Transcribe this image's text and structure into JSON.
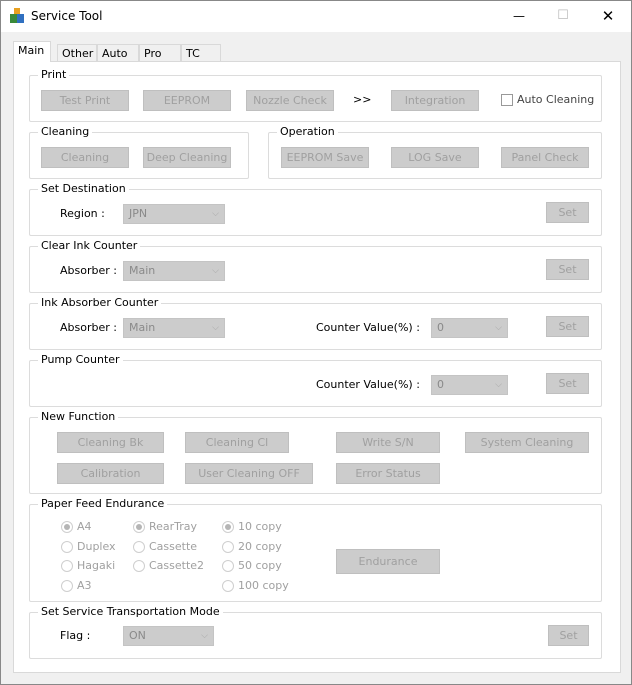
{
  "window": {
    "title": "Service Tool",
    "minimize": "—",
    "maximize": "☐",
    "close": "✕"
  },
  "tabs": [
    "Main",
    "Other",
    "Auto",
    "Pro",
    "TC"
  ],
  "print": {
    "label": "Print",
    "test_print": "Test Print",
    "eeprom": "EEPROM",
    "nozzle_check": "Nozzle Check",
    "arrow": ">>",
    "integration": "Integration",
    "auto_cleaning": "Auto Cleaning",
    "auto_cleaning_checked": false
  },
  "cleaning": {
    "label": "Cleaning",
    "cleaning": "Cleaning",
    "deep_cleaning": "Deep Cleaning"
  },
  "operation": {
    "label": "Operation",
    "eeprom_save": "EEPROM Save",
    "log_save": "LOG Save",
    "panel_check": "Panel Check"
  },
  "set_destination": {
    "label": "Set Destination",
    "region_label": "Region :",
    "region_value": "JPN",
    "set": "Set"
  },
  "clear_ink_counter": {
    "label": "Clear Ink Counter",
    "absorber_label": "Absorber :",
    "absorber_value": "Main",
    "set": "Set"
  },
  "ink_absorber_counter": {
    "label": "Ink Absorber Counter",
    "absorber_label": "Absorber :",
    "absorber_value": "Main",
    "counter_label": "Counter Value(%) :",
    "counter_value": "0",
    "set": "Set"
  },
  "pump_counter": {
    "label": "Pump Counter",
    "counter_label": "Counter Value(%) :",
    "counter_value": "0",
    "set": "Set"
  },
  "new_function": {
    "label": "New Function",
    "cleaning_bk": "Cleaning Bk",
    "cleaning_cl": "Cleaning Cl",
    "write_sn": "Write S/N",
    "system_cleaning": "System Cleaning",
    "calibration": "Calibration",
    "user_cleaning_off": "User Cleaning OFF",
    "error_status": "Error Status"
  },
  "paper_feed": {
    "label": "Paper Feed Endurance",
    "size": [
      "A4",
      "Duplex",
      "Hagaki",
      "A3"
    ],
    "tray": [
      "RearTray",
      "Cassette",
      "Cassette2"
    ],
    "copies": [
      "10 copy",
      "20 copy",
      "50 copy",
      "100 copy"
    ],
    "endurance": "Endurance"
  },
  "transport": {
    "label": "Set Service Transportation Mode",
    "flag_label": "Flag :",
    "flag_value": "ON",
    "set": "Set"
  }
}
